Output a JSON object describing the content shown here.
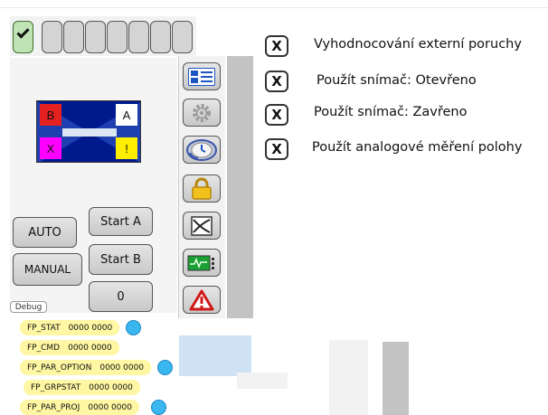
{
  "state_strip": {
    "cells": 9,
    "active_index": 0
  },
  "valve": {
    "badge_b": "B",
    "badge_a": "A",
    "badge_x": "X",
    "badge_warn": "!"
  },
  "buttons": {
    "auto": "AUTO",
    "manual": "MANUAL",
    "start_a": "Start A",
    "start_b": "Start B",
    "zero": "0"
  },
  "debug_label": "Debug",
  "icons": [
    "faceplate-icon",
    "gear-icon",
    "clock-arrow-icon",
    "lock-icon",
    "trend-icon",
    "diagnostic-icon",
    "warning-icon"
  ],
  "options": [
    {
      "mark": "X",
      "label": "Vyhodnocování externí poruchy"
    },
    {
      "mark": "X",
      "label": "Použít snímač: Otevřeno"
    },
    {
      "mark": "X",
      "label": "Použít snímač: Zavřeno"
    },
    {
      "mark": "X",
      "label": "Použít analogové měření polohy"
    }
  ],
  "fp_tags": [
    {
      "name": "FP_STAT",
      "value": "0000 0000"
    },
    {
      "name": "FP_CMD",
      "value": "0000 0000"
    },
    {
      "name": "FP_PAR_OPTION",
      "value": "0000 0000"
    },
    {
      "name": "FP_GRPSTAT",
      "value": "0000 0000"
    },
    {
      "name": "FP_PAR_PROJ",
      "value": "0000 0000"
    }
  ],
  "colors": {
    "valve_body": "#001a8e",
    "badge_b": "#e52020",
    "badge_x": "#ff00ff",
    "badge_warn": "#ffee00",
    "tag_bg": "#fff7a3",
    "tag_dot": "#39b7ee",
    "panel_gray": "#c3c3c3",
    "state_active": "#bfe3b4"
  }
}
